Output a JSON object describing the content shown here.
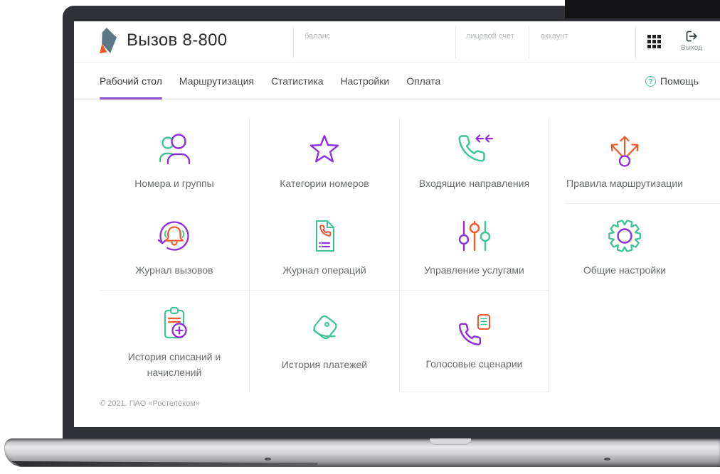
{
  "app": {
    "title": "Вызов 8-800"
  },
  "header": {
    "fields": [
      {
        "label": "баланс"
      },
      {
        "label": "лицевой счет"
      },
      {
        "label": "аккаунт"
      }
    ],
    "apps_icon": "grid-icon",
    "logout": {
      "label": "Выход",
      "icon": "logout-icon"
    }
  },
  "nav": {
    "tabs": [
      {
        "label": "Рабочий стол",
        "active": true
      },
      {
        "label": "Маршрутизация",
        "active": false
      },
      {
        "label": "Статистика",
        "active": false
      },
      {
        "label": "Настройки",
        "active": false
      },
      {
        "label": "Оплата",
        "active": false
      }
    ],
    "help": {
      "label": "Помощь",
      "icon": "question-icon"
    }
  },
  "tiles": [
    {
      "label": "Номера и группы",
      "icon": "users-icon"
    },
    {
      "label": "Категории номеров",
      "icon": "star-icon"
    },
    {
      "label": "Входящие направления",
      "icon": "incoming-call-icon"
    },
    {
      "label": "Правила маршрутизации",
      "icon": "routing-icon"
    },
    {
      "label": "Журнал вызовов",
      "icon": "call-log-icon"
    },
    {
      "label": "Журнал операций",
      "icon": "operations-log-icon"
    },
    {
      "label": "Управление услугами",
      "icon": "sliders-icon"
    },
    {
      "label": "Общие настройки",
      "icon": "gear-icon"
    },
    {
      "label": "История списаний и начислений",
      "icon": "clipboard-plus-icon"
    },
    {
      "label": "История платежей",
      "icon": "wallet-icon"
    },
    {
      "label": "Голосовые сценарии",
      "icon": "voice-script-icon"
    }
  ],
  "footer": {
    "copyright": "© 2021. ПАО «Ростелеком»"
  },
  "colors": {
    "purple": "#8e2fe0",
    "teal": "#3fc495",
    "orange": "#f1592b",
    "red_orange": "#ee4d2e",
    "tab_underline": "#8a4bd1",
    "help_green": "#42c79c"
  }
}
